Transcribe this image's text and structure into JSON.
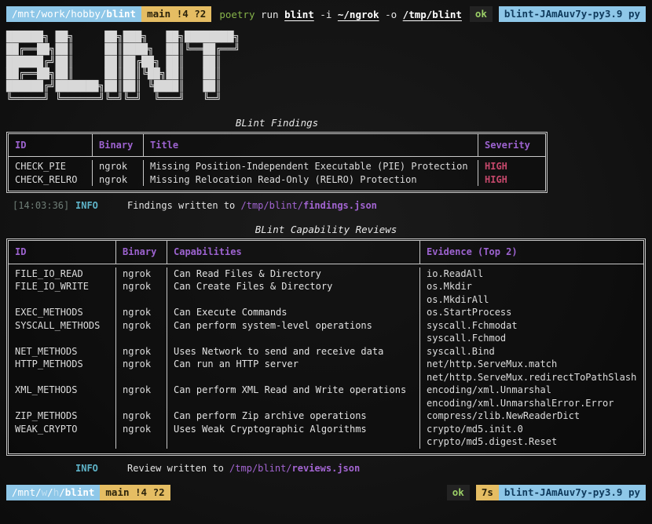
{
  "colors": {
    "background": "#131313",
    "foreground": "#dcdcdc",
    "table_border": "#c9c9c9",
    "header_purple": "#9d63d0",
    "path_purple": "#a365d2",
    "severity_high": "#c4486b",
    "info_cyan": "#5fb4c9",
    "timestamp_gray": "#6e7d76",
    "chip_blue": "#8ec7e8",
    "chip_yellow": "#e5bd63",
    "ok_green": "#9bcf67",
    "poetry_green": "#86b34a",
    "logo_gray": "#d8d8d8"
  },
  "top_prompt": {
    "cwd": "/mnt/work/hobby/",
    "cwd_bold": "blint",
    "git_status": "main !4 ?2",
    "command": [
      {
        "text": "poetry",
        "style": "program"
      },
      {
        "text": " run ",
        "style": "plain"
      },
      {
        "text": "blint",
        "style": "arg-path"
      },
      {
        "text": " -i ",
        "style": "plain"
      },
      {
        "text": "~/ngrok",
        "style": "arg-path"
      },
      {
        "text": " -o ",
        "style": "plain"
      },
      {
        "text": "/tmp/blint",
        "style": "arg-path"
      }
    ],
    "exit_status": "ok",
    "venv": "blint-JAmAuv7y-py3.9 py"
  },
  "logo_art": "██████╗ ██╗     ██╗███╗   ██╗████████╗\n██╔══██╗██║     ██║████╗  ██║╚══██╔══╝\n██████╔╝██║     ██║██╔██╗ ██║   ██║   \n██╔══██╗██║     ██║██║╚██╗██║   ██║   \n██████╔╝███████╗██║██║ ╚████║   ██║   \n╚═════╝ ╚══════╝╚═╝╚═╝  ╚═══╝   ╚═╝   ",
  "findings": {
    "title": "BLint Findings",
    "columns": [
      "ID",
      "Binary",
      "Title",
      "Severity"
    ],
    "rows": [
      {
        "id": "CHECK_PIE",
        "binary": "ngrok",
        "title": "Missing Position-Independent Executable (PIE) Protection",
        "severity": "HIGH"
      },
      {
        "id": "CHECK_RELRO",
        "binary": "ngrok",
        "title": "Missing Relocation Read-Only (RELRO) Protection",
        "severity": "HIGH"
      }
    ]
  },
  "findings_log": {
    "time": "[14:03:36]",
    "level": "INFO",
    "message": "Findings written to ",
    "path_prefix": "/tmp/blint/",
    "path_file": "findings.json"
  },
  "reviews": {
    "title": "BLint Capability Reviews",
    "columns": [
      "ID",
      "Binary",
      "Capabilities",
      "Evidence (Top 2)"
    ],
    "rows": [
      {
        "id": "FILE_IO_READ",
        "binary": "ngrok",
        "capabilities": "Can Read Files & Directory",
        "evidence": [
          "io.ReadAll"
        ]
      },
      {
        "id": "FILE_IO_WRITE",
        "binary": "ngrok",
        "capabilities": "Can Create Files & Directory",
        "evidence": [
          "os.Mkdir",
          "os.MkdirAll"
        ]
      },
      {
        "id": "EXEC_METHODS",
        "binary": "ngrok",
        "capabilities": "Can Execute Commands",
        "evidence": [
          "os.StartProcess"
        ]
      },
      {
        "id": "SYSCALL_METHODS",
        "binary": "ngrok",
        "capabilities": "Can perform system-level operations",
        "evidence": [
          "syscall.Fchmodat",
          "syscall.Fchmod"
        ]
      },
      {
        "id": "NET_METHODS",
        "binary": "ngrok",
        "capabilities": "Uses Network to send and receive data",
        "evidence": [
          "syscall.Bind"
        ]
      },
      {
        "id": "HTTP_METHODS",
        "binary": "ngrok",
        "capabilities": "Can run an HTTP server",
        "evidence": [
          "net/http.ServeMux.match",
          "net/http.ServeMux.redirectToPathSlash"
        ]
      },
      {
        "id": "XML_METHODS",
        "binary": "ngrok",
        "capabilities": "Can perform XML Read and Write operations",
        "evidence": [
          "encoding/xml.Unmarshal",
          "encoding/xml.UnmarshalError.Error"
        ]
      },
      {
        "id": "ZIP_METHODS",
        "binary": "ngrok",
        "capabilities": "Can perform Zip archive operations",
        "evidence": [
          "compress/zlib.NewReaderDict"
        ]
      },
      {
        "id": "WEAK_CRYPTO",
        "binary": "ngrok",
        "capabilities": "Uses Weak Cryptographic Algorithms",
        "evidence": [
          "crypto/md5.init.0",
          "crypto/md5.digest.Reset"
        ]
      }
    ]
  },
  "reviews_log": {
    "time": "",
    "level": "INFO",
    "message": "Review written to ",
    "path_prefix": "/tmp/blint/",
    "path_file": "reviews.json"
  },
  "bottom_prompt": {
    "path_segments": [
      {
        "text": "/mnt/",
        "style": "bright"
      },
      {
        "text": "w",
        "style": "dim"
      },
      {
        "text": "/",
        "style": "bright"
      },
      {
        "text": "h",
        "style": "dim"
      },
      {
        "text": "/",
        "style": "bright"
      },
      {
        "text": "blint",
        "style": "bold"
      }
    ],
    "git_status": "main !4 ?2",
    "exit_status": "ok",
    "duration": "7s",
    "venv": "blint-JAmAuv7y-py3.9 py"
  }
}
